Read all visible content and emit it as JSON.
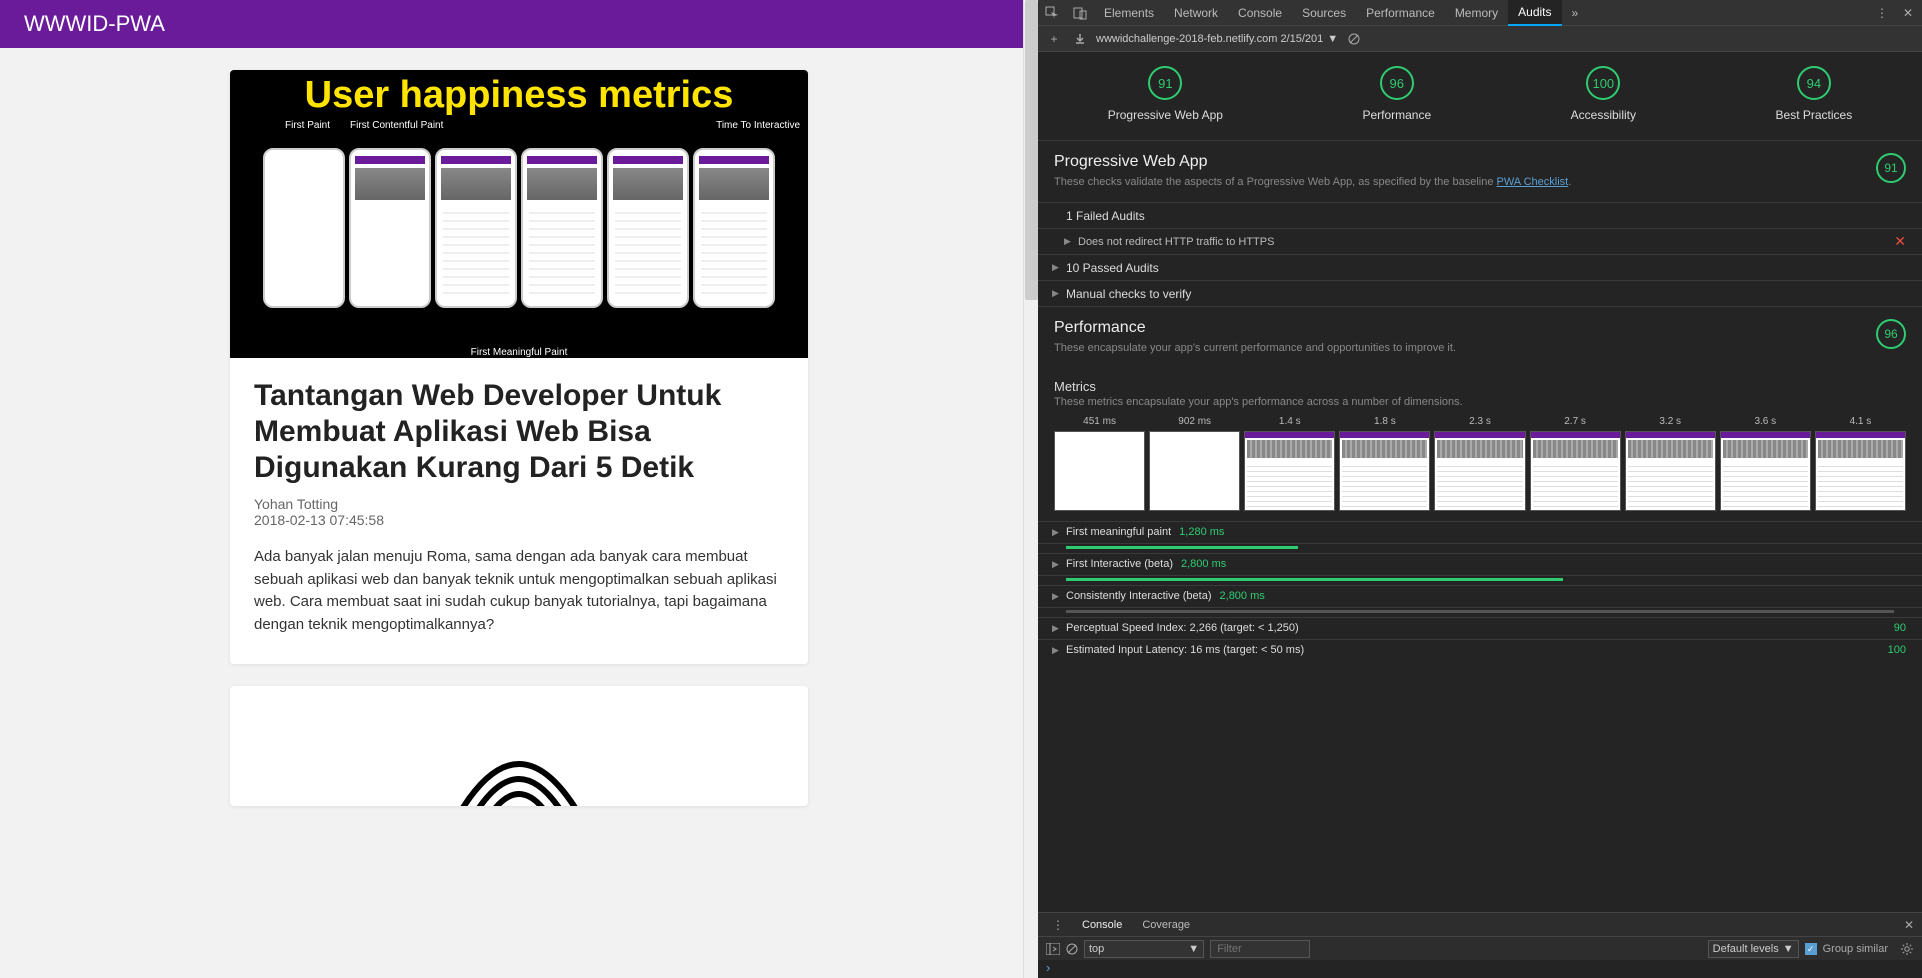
{
  "app": {
    "title": "WWWID-PWA"
  },
  "article": {
    "hero_title": "User happiness metrics",
    "hero_label_fp": "First Paint",
    "hero_label_fcp": "First Contentful Paint",
    "hero_label_tti": "Time To Interactive",
    "hero_label_fmp": "First Meaningful Paint",
    "title": "Tantangan Web Developer Untuk Membuat Aplikasi Web Bisa Digunakan Kurang Dari 5 Detik",
    "author": "Yohan Totting",
    "date": "2018-02-13 07:45:58",
    "excerpt": "Ada banyak jalan menuju Roma, sama dengan ada banyak cara membuat sebuah aplikasi web dan banyak teknik untuk mengoptimalkan sebuah aplikasi web. Cara membuat saat ini sudah cukup banyak tutorialnya, tapi bagaimana dengan teknik mengoptimalkannya?"
  },
  "devtools": {
    "tabs": [
      "Elements",
      "Network",
      "Console",
      "Sources",
      "Performance",
      "Memory",
      "Audits"
    ],
    "active_tab": "Audits",
    "url": "wwwidchallenge-2018-feb.netlify.com 2/15/201",
    "scores": [
      {
        "value": "91",
        "label": "Progressive Web App"
      },
      {
        "value": "96",
        "label": "Performance"
      },
      {
        "value": "100",
        "label": "Accessibility"
      },
      {
        "value": "94",
        "label": "Best Practices"
      }
    ],
    "pwa": {
      "title": "Progressive Web App",
      "desc": "These checks validate the aspects of a Progressive Web App, as specified by the baseline ",
      "link": "PWA Checklist",
      "score": "91",
      "failed": "1 Failed Audits",
      "fail_item": "Does not redirect HTTP traffic to HTTPS",
      "passed": "10 Passed Audits",
      "manual": "Manual checks to verify"
    },
    "perf": {
      "title": "Performance",
      "desc": "These encapsulate your app's current performance and opportunities to improve it.",
      "score": "96",
      "metrics_title": "Metrics",
      "metrics_desc": "These metrics encapsulate your app's performance across a number of dimensions.",
      "filmstrip_times": [
        "451 ms",
        "902 ms",
        "1.4 s",
        "1.8 s",
        "2.3 s",
        "2.7 s",
        "3.2 s",
        "3.6 s",
        "4.1 s"
      ],
      "metrics": [
        {
          "name": "First meaningful paint",
          "value": "1,280 ms"
        },
        {
          "name": "First Interactive (beta)",
          "value": "2,800 ms"
        },
        {
          "name": "Consistently Interactive (beta)",
          "value": "2,800 ms"
        }
      ],
      "psi": {
        "name": "Perceptual Speed Index: 2,266 (target: < 1,250)",
        "score": "90"
      },
      "eil": {
        "name": "Estimated Input Latency: 16 ms (target: < 50 ms)",
        "score": "100"
      }
    },
    "drawer": {
      "tabs": [
        "Console",
        "Coverage"
      ],
      "context": "top",
      "filter_placeholder": "Filter",
      "levels": "Default levels",
      "group": "Group similar"
    }
  }
}
